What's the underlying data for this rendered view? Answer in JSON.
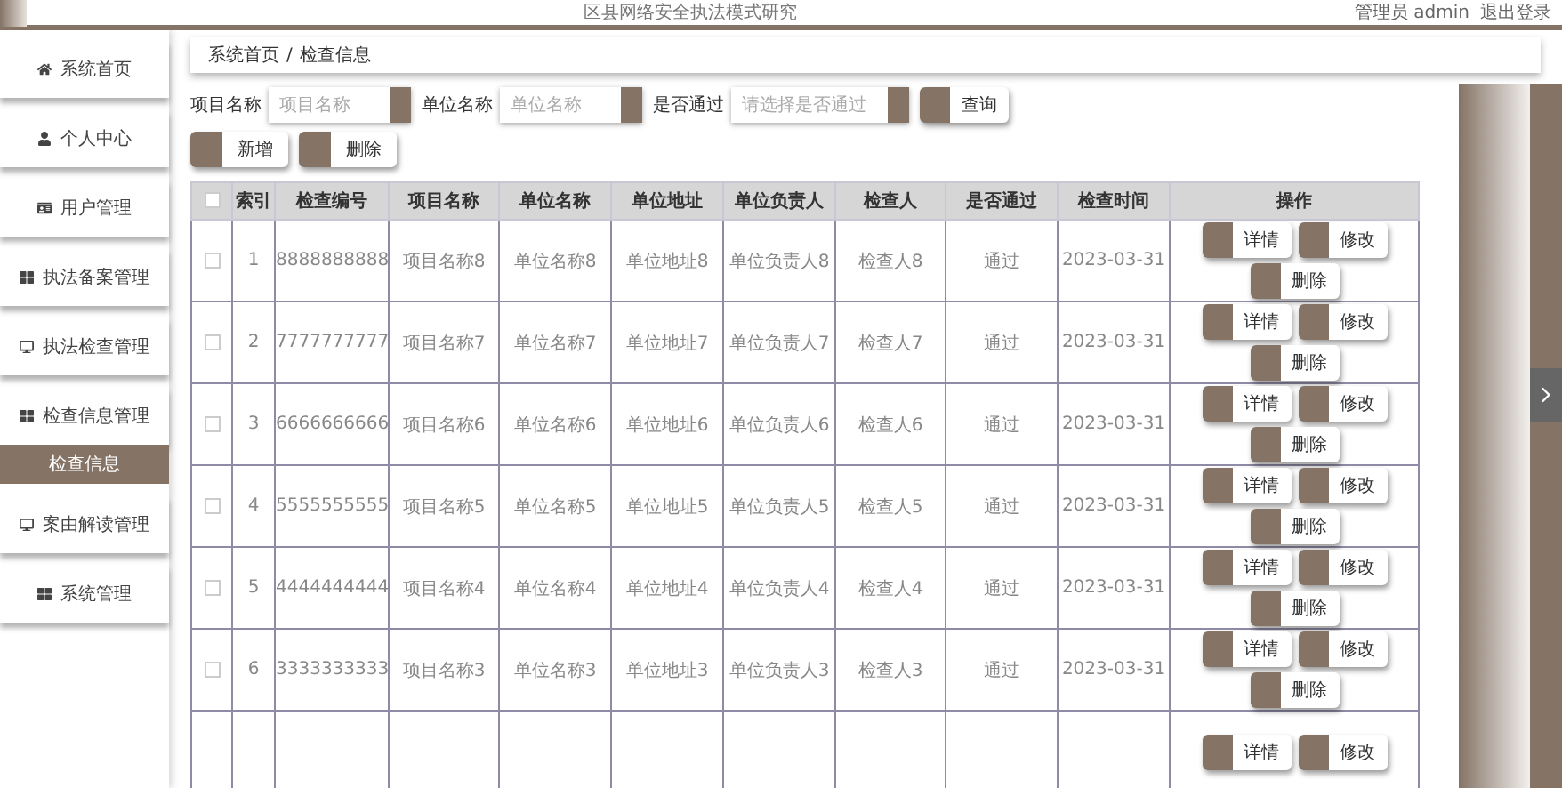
{
  "header": {
    "title": "区县网络安全执法模式研究",
    "user": "管理员 admin",
    "logout": "退出登录"
  },
  "sidebar": {
    "items": [
      {
        "label": "系统首页",
        "selected": false
      },
      {
        "label": "个人中心",
        "selected": false
      },
      {
        "label": "用户管理",
        "selected": false
      },
      {
        "label": "执法备案管理",
        "selected": false
      },
      {
        "label": "执法检查管理",
        "selected": false
      },
      {
        "label": "检查信息管理",
        "selected": false,
        "children": [
          {
            "label": "检查信息",
            "selected": true
          }
        ]
      },
      {
        "label": "案由解读管理",
        "selected": false
      },
      {
        "label": "系统管理",
        "selected": false
      }
    ]
  },
  "breadcrumb": [
    "系统首页",
    "/",
    "检查信息"
  ],
  "filters": [
    {
      "label": "项目名称",
      "placeholder": "项目名称"
    },
    {
      "label": "单位名称",
      "placeholder": "单位名称"
    },
    {
      "label": "是否通过",
      "placeholder": "请选择是否通过"
    }
  ],
  "search_button": "查询",
  "toolbar": [
    "新增",
    "删除"
  ],
  "table": {
    "select_all_checked": false,
    "columns": [
      "索引",
      "检查编号",
      "项目名称",
      "单位名称",
      "单位地址",
      "单位负责人",
      "检查人",
      "是否通过",
      "检查时间",
      "操作"
    ],
    "rows": [
      {
        "checked": false,
        "cells": [
          "1",
          "8888888888",
          "项目名称8",
          "单位名称8",
          "单位地址8",
          "单位负责人8",
          "检查人8",
          "通过",
          "2023-03-31"
        ],
        "actions": [
          "详情",
          "修改",
          "删除"
        ]
      },
      {
        "checked": false,
        "cells": [
          "2",
          "7777777777",
          "项目名称7",
          "单位名称7",
          "单位地址7",
          "单位负责人7",
          "检查人7",
          "通过",
          "2023-03-31"
        ],
        "actions": [
          "详情",
          "修改",
          "删除"
        ]
      },
      {
        "checked": false,
        "cells": [
          "3",
          "6666666666",
          "项目名称6",
          "单位名称6",
          "单位地址6",
          "单位负责人6",
          "检查人6",
          "通过",
          "2023-03-31"
        ],
        "actions": [
          "详情",
          "修改",
          "删除"
        ]
      },
      {
        "checked": false,
        "cells": [
          "4",
          "5555555555",
          "项目名称5",
          "单位名称5",
          "单位地址5",
          "单位负责人5",
          "检查人5",
          "通过",
          "2023-03-31"
        ],
        "actions": [
          "详情",
          "修改",
          "删除"
        ]
      },
      {
        "checked": false,
        "cells": [
          "5",
          "4444444444",
          "项目名称4",
          "单位名称4",
          "单位地址4",
          "单位负责人4",
          "检查人4",
          "通过",
          "2023-03-31"
        ],
        "actions": [
          "详情",
          "修改",
          "删除"
        ]
      },
      {
        "checked": false,
        "cells": [
          "6",
          "3333333333",
          "项目名称3",
          "单位名称3",
          "单位地址3",
          "单位负责人3",
          "检查人3",
          "通过",
          "2023-03-31"
        ],
        "actions": [
          "详情",
          "修改",
          "删除"
        ]
      },
      {
        "cells": [],
        "actions": [
          "详情",
          "修改"
        ]
      }
    ]
  }
}
